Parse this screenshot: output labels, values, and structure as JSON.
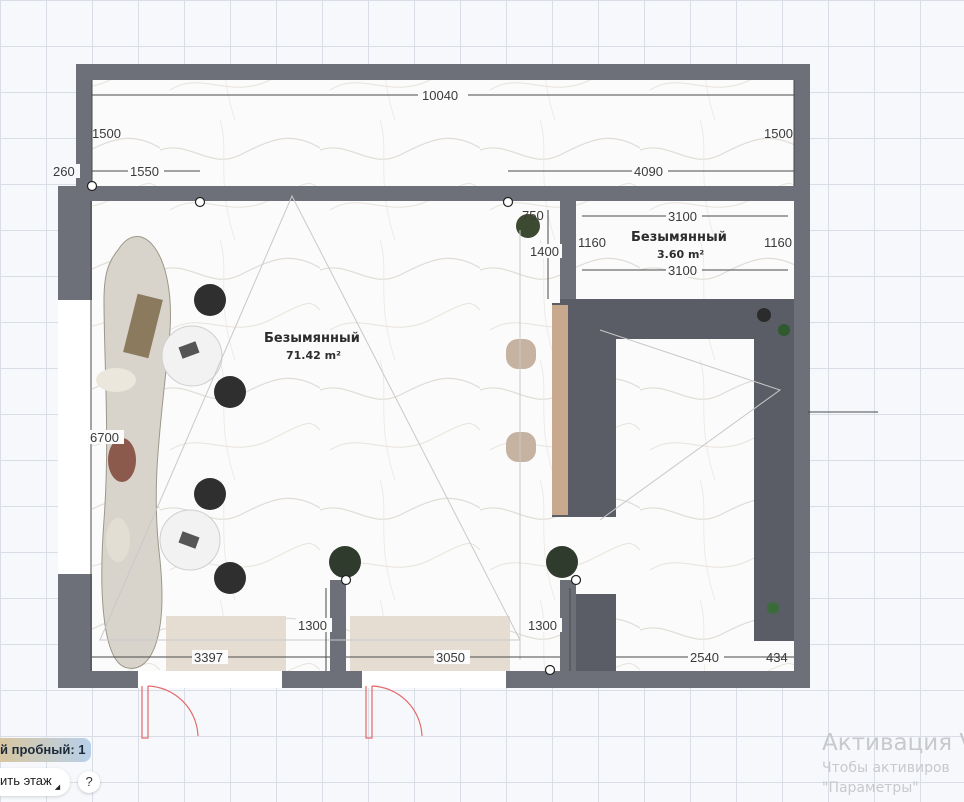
{
  "plan": {
    "rooms": [
      {
        "name": "Безымянный",
        "area": "71.42 m²"
      },
      {
        "name": "Безымянный",
        "area": "3.60 m²"
      }
    ],
    "dimensions": {
      "top_width": "10040",
      "left_upper": "1500",
      "right_upper": "1500",
      "wall_left": "260",
      "segment_left": "1550",
      "segment_right": "4090",
      "niche_width_top": "3100",
      "niche_width_bottom": "3100",
      "niche_height_left": "1160",
      "niche_height_right": "1160",
      "small_750": "750",
      "small_1400": "1400",
      "left_height": "6700",
      "bottom_left": "3397",
      "bottom_mid": "3050",
      "bottom_right": "2540",
      "bottom_corner": "434",
      "wall_1300_left": "1300",
      "wall_1300_right": "1300"
    },
    "colors": {
      "wall": "#6d7078",
      "cabinet": "#5a5d66",
      "marble": "#ffffff",
      "door": "#e26a6a"
    }
  },
  "floor_panel": {
    "floor_label": "й пробный: 1",
    "floor_action": "ить этаж",
    "help": "?"
  },
  "watermark": {
    "title": "Активация V",
    "line1": "Чтобы активиров",
    "line2": "\"Параметры\""
  }
}
